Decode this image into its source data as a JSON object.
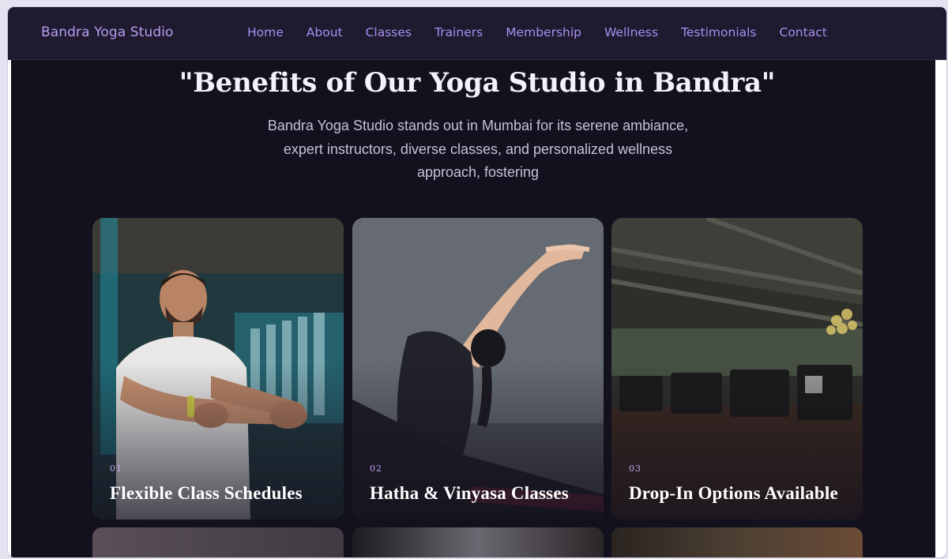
{
  "nav": {
    "brand": "Bandra Yoga Studio",
    "links": [
      "Home",
      "About",
      "Classes",
      "Trainers",
      "Membership",
      "Wellness",
      "Testimonials",
      "Contact"
    ]
  },
  "hero": {
    "title": "\"Benefits of Our Yoga Studio in Bandra\"",
    "description": "Bandra Yoga Studio stands out in Mumbai for its serene ambiance, expert instructors, diverse classes, and personalized wellness approach, fostering"
  },
  "cards": [
    {
      "number": "01",
      "title": "Flexible Class Schedules"
    },
    {
      "number": "02",
      "title": "Hatha & Vinyasa Classes"
    },
    {
      "number": "03",
      "title": "Drop-In Options Available"
    }
  ]
}
